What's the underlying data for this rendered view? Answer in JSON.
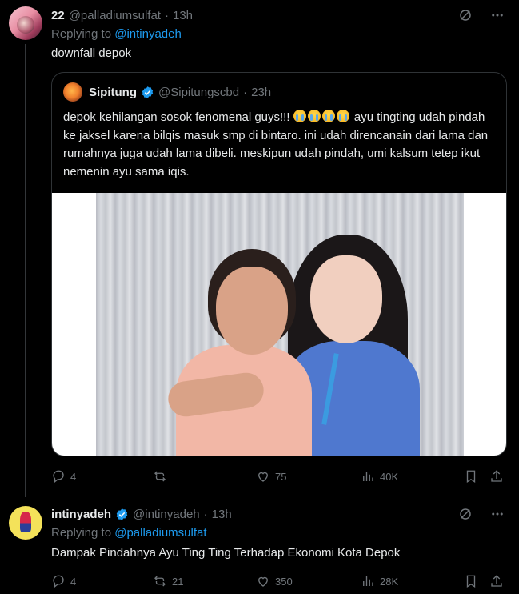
{
  "thread": {
    "reply1": {
      "name": "22",
      "handle": "@palladiumsulfat",
      "time": "13h",
      "replying_prefix": "Replying to",
      "replying_mention": "@intinyadeh",
      "text": "downfall depok",
      "actions": {
        "replies": "4",
        "reposts": "",
        "likes": "75",
        "views": "40K"
      },
      "quote": {
        "name": "Sipitung",
        "handle": "@Sipitungscbd",
        "time": "23h",
        "text_part1": "depok kehilangan sosok fenomenal guys!!!",
        "text_part2": " ayu tingting udah pindah ke jaksel karena bilqis masuk smp di bintaro. ini udah direncanain dari lama dan rumahnya juga udah lama dibeli. meskipun udah pindah, umi kalsum tetep ikut nemenin ayu sama iqis.",
        "emojis": [
          "loudly-crying-face",
          "loudly-crying-face",
          "loudly-crying-face",
          "loudly-crying-face"
        ]
      }
    },
    "reply2": {
      "name": "intinyadeh",
      "handle": "@intinyadeh",
      "time": "13h",
      "replying_prefix": "Replying to",
      "replying_mention": "@palladiumsulfat",
      "text": "Dampak Pindahnya Ayu Ting Ting Terhadap Ekonomi Kota Depok",
      "actions": {
        "replies": "4",
        "reposts": "21",
        "likes": "350",
        "views": "28K"
      }
    }
  },
  "separator": "·",
  "colors": {
    "background": "#000000",
    "text": "#e7e9ea",
    "muted": "#71767b",
    "accent": "#1d9bf0",
    "border": "#2f3336"
  }
}
